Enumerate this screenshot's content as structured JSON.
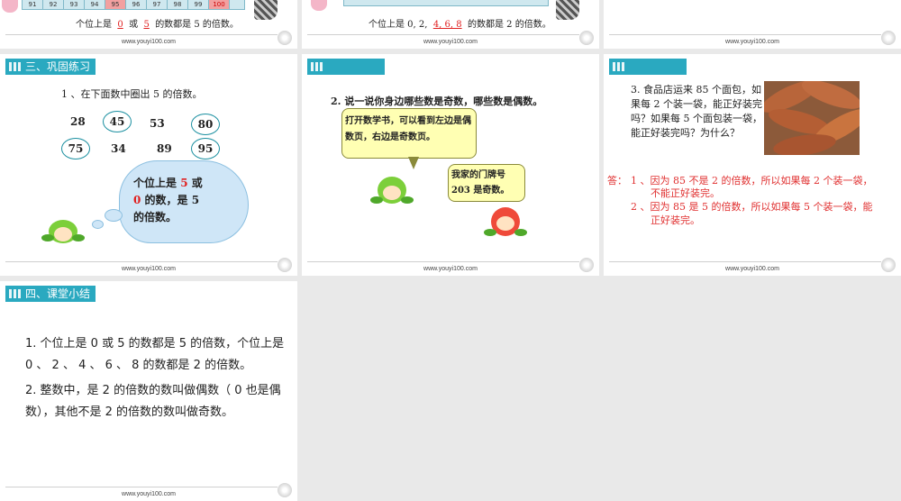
{
  "footer_url": "www.youyi100.com",
  "s1": {
    "strip": [
      "91",
      "92",
      "93",
      "94",
      "95",
      "96",
      "97",
      "98",
      "99",
      "100"
    ],
    "t_prefix": "个位上是",
    "blank1": "0",
    "t_mid": "或",
    "blank2": "5",
    "t_suffix": "的数都是 5 的倍数。"
  },
  "s2": {
    "t_prefix": "个位上是 0, 2,",
    "blank": "4, 6, 8",
    "t_suffix": "的数都是 2 的倍数。"
  },
  "s4": {
    "section": "三、巩固练习",
    "question": "1 、在下面数中圈出 5 的倍数。",
    "numbers": [
      "28",
      "45",
      "53",
      "80",
      "75",
      "34",
      "89",
      "95"
    ],
    "cloud_line1_a": "个位上是",
    "cloud_line1_b": "5",
    "cloud_line1_c": "或",
    "cloud_line2_a": "0",
    "cloud_line2_b": "的数，是 5",
    "cloud_line3": "的倍数。"
  },
  "s5": {
    "question": "2.   说一说你身边哪些数是奇数，哪些数是偶数。",
    "bubble1": "打开数学书，可以看到左边是偶数页，右边是奇数页。",
    "bubble2_l1": "我家的门牌号",
    "bubble2_l2": "203  是奇数。"
  },
  "s6": {
    "question": "3. 食品店运来 85 个面包，如果每 2 个装一袋，能正好装完吗？如果每 5 个面包装一袋，能正好装完吗？为什么？",
    "ans_label": "答：",
    "ans1_a": "1 、因为 85 不是 2 的倍数，所以如果每 2 个装一袋，",
    "ans1_b": "不能正好装完。",
    "ans2_a": "2 、因为 85 是 5 的倍数，所以如果每 5 个装一袋，能",
    "ans2_b": "正好装完。"
  },
  "s7": {
    "section": "四、课堂小结",
    "p1": "1. 个位上是 0 或 5 的数都是 5 的倍数，个位上是 0 、 2 、 4 、 6 、 8 的数都是 2 的倍数。",
    "p2": "2. 整数中，是 2 的倍数的数叫做偶数（ 0 也是偶数），其他不是 2 的倍数的数叫做奇数。"
  },
  "colors": {
    "section_bar": "#2aa9c0",
    "highlight_red": "#e02020",
    "circle": "#1a8fa0"
  }
}
